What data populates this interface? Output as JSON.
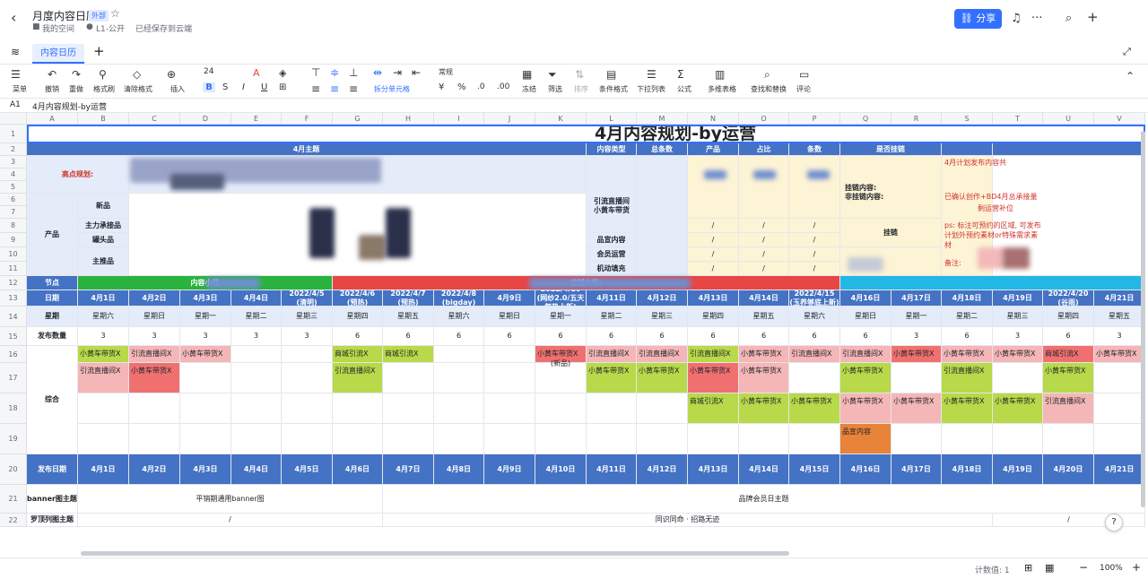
{
  "header": {
    "title": "月度内容日历",
    "badge": "外部",
    "breadcrumb_space": "我的空间",
    "breadcrumb_level": "L1-公开",
    "save_status": "已经保存到云端",
    "share_label": "分享"
  },
  "tabs": [
    {
      "label": "内容日历"
    }
  ],
  "toolbar": {
    "items": [
      {
        "label": "菜单"
      },
      {
        "label": "撤销"
      },
      {
        "label": "重做"
      },
      {
        "label": "格式刷"
      },
      {
        "label": "清除格式"
      },
      {
        "label": "插入"
      },
      {
        "label": "冻结"
      },
      {
        "label": "筛选"
      },
      {
        "label": "排序"
      },
      {
        "label": "条件格式"
      },
      {
        "label": "下拉列表"
      },
      {
        "label": "公式"
      },
      {
        "label": "多维表格"
      },
      {
        "label": "查找和替换"
      },
      {
        "label": "评论"
      }
    ],
    "font_size": "24",
    "number_format": "常规",
    "merge_label": "拆分单元格"
  },
  "formula_bar": {
    "cell_ref": "A1",
    "content": "4月内容规划-by运营"
  },
  "columns": [
    "A",
    "B",
    "C",
    "D",
    "E",
    "F",
    "G",
    "H",
    "I",
    "J",
    "K",
    "L",
    "M",
    "N",
    "O",
    "P",
    "Q",
    "R",
    "S",
    "T",
    "U",
    "V"
  ],
  "rows": [
    "1",
    "2",
    "3",
    "4",
    "5",
    "6",
    "7",
    "8",
    "9",
    "10",
    "11",
    "12",
    "13",
    "14",
    "15",
    "16",
    "17",
    "18",
    "19",
    "20",
    "21",
    "22"
  ],
  "sheet": {
    "title": "4月内容规划-by运营",
    "r2": {
      "theme": "4月主题",
      "content_type": "内容类型",
      "total": "总条数",
      "product": "产品",
      "ratio": "占比",
      "count": "条数",
      "hang_link": "是否挂链",
      "plan_note": "4月计划发布内容共"
    },
    "highlight_label": "高点规划:",
    "product_label": "产品",
    "sub_rows": {
      "new": "新品",
      "main_push": "主力承接品",
      "hook": "罐头品",
      "main_push2": "主推品"
    },
    "content_types": {
      "t1a": "引流直播间",
      "t1b": "小黄车带货",
      "t2": "品宣内容",
      "t3": "会员运营",
      "t4": "机动填充"
    },
    "hang": {
      "yes": "挂链内容:",
      "no": "非挂链内容:",
      "hang": "挂链"
    },
    "notes": {
      "n2": "已确认创作+BD4月总承接量",
      "n2b": "剩运营补位",
      "n3": "ps: 标注可预约的区域, 可发布计划外预约素材or特殊需求素材",
      "n4": "备注:"
    },
    "slash": "/",
    "r12": {
      "label": "节点",
      "seg1": "内容小场",
      "seg2": "店铺大场:"
    },
    "dates": [
      "4月1日",
      "4月2日",
      "4月3日",
      "4月4日",
      "2022/4/5\n(清明)",
      "2022/4/6\n(预热)",
      "2022/4/7\n(预热)",
      "2022/4/8\n(bigday)",
      "4月9日",
      "2022/4/10\n(网纱2.0/五天气热上新)",
      "4月11日",
      "4月12日",
      "4月13日",
      "4月14日",
      "2022/4/15\n(玉养够底上新)",
      "4月16日",
      "4月17日",
      "4月18日",
      "4月19日",
      "2022/4/20\n(谷雨)",
      "4月21日"
    ],
    "weekdays": [
      "星期六",
      "星期日",
      "星期一",
      "星期二",
      "星期三",
      "星期四",
      "星期五",
      "星期六",
      "星期日",
      "星期一",
      "星期二",
      "星期三",
      "星期四",
      "星期五",
      "星期六",
      "星期日",
      "星期一",
      "星期二",
      "星期三",
      "星期四",
      "星期五"
    ],
    "counts": [
      "3",
      "3",
      "3",
      "3",
      "3",
      "6",
      "6",
      "6",
      "6",
      "6",
      "6",
      "6",
      "6",
      "6",
      "6",
      "6",
      "3",
      "6",
      "3",
      "6",
      "3"
    ],
    "date_label": "日期",
    "weekday_label": "星期",
    "count_label": "发布数量",
    "combo_label": "综合",
    "r20_label": "发布日期",
    "r20_dates": [
      "4月1日",
      "4月2日",
      "4月3日",
      "4月4日",
      "4月5日",
      "4月6日",
      "4月7日",
      "4月8日",
      "4月9日",
      "4月10日",
      "4月11日",
      "4月12日",
      "4月13日",
      "4月14日",
      "4月15日",
      "4月16日",
      "4月17日",
      "4月18日",
      "4月19日",
      "4月20日",
      "4月21日"
    ],
    "r21": {
      "label": "banner图主题",
      "a": "平销期通用banner图",
      "b": "品牌会员日主题"
    },
    "r22": {
      "label": "罗顶列图主题",
      "a": "/",
      "b": "同识同命 · 招路无迹",
      "c": "/"
    },
    "cells": {
      "gw": "小黄车带货X",
      "yl": "引流直播间X",
      "sc": "商城引流X",
      "xp": "(新品)",
      "pxnr": "品宣内容"
    }
  },
  "footer": {
    "count": "计数值: 1",
    "zoom": "100%"
  },
  "colors": {
    "blue": "#4472c4",
    "green": "#29b33e",
    "red": "#e84545",
    "cyan": "#22b7e4",
    "olive": "#b7d94a",
    "pink": "#f4b6b6",
    "red_cell": "#f07070",
    "orange": "#e8833a",
    "yellow": "#fdf3d5",
    "lightblue": "#e4ecfa"
  }
}
